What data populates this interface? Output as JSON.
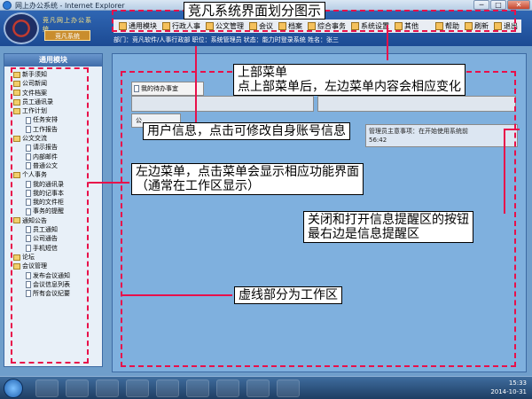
{
  "window": {
    "title": "网上办公系统 - Internet Explorer",
    "min": "─",
    "max": "□",
    "close": "✕"
  },
  "header": {
    "logo_text": "竞凡网上办公系统",
    "logo_sub": "竞凡系统",
    "top_menu": [
      "通用模块",
      "行政人事",
      "公文管理",
      "会议",
      "档案",
      "综合事务",
      "系统设置",
      "其他"
    ],
    "right_links": [
      "帮助",
      "刷新",
      "退出"
    ],
    "user_info": "部门：竞凡软件/人事行政部  职位：系统管理员  状态：能力时登录系统  姓名：张三"
  },
  "sidebar": {
    "title": "通用模块",
    "items": [
      {
        "label": "新手须知",
        "level": 0
      },
      {
        "label": "公司新闻",
        "level": 0
      },
      {
        "label": "文件档案",
        "level": 0
      },
      {
        "label": "员工通讯录",
        "level": 0
      },
      {
        "label": "工作计划",
        "level": 0
      },
      {
        "label": "任务安排",
        "level": 1
      },
      {
        "label": "工作报告",
        "level": 1
      },
      {
        "label": "公文交流",
        "level": 0
      },
      {
        "label": "请示报告",
        "level": 1
      },
      {
        "label": "内部邮件",
        "level": 1
      },
      {
        "label": "普通公文",
        "level": 1
      },
      {
        "label": "个人事务",
        "level": 0
      },
      {
        "label": "我的通讯录",
        "level": 1
      },
      {
        "label": "我的记事本",
        "level": 1
      },
      {
        "label": "我的文件柜",
        "level": 1
      },
      {
        "label": "事务的提醒",
        "level": 1
      },
      {
        "label": "通知公告",
        "level": 0
      },
      {
        "label": "员工通知",
        "level": 1
      },
      {
        "label": "公司通告",
        "level": 1
      },
      {
        "label": "手机短信",
        "level": 1
      },
      {
        "label": "论坛",
        "level": 0
      },
      {
        "label": "会议管理",
        "level": 0
      },
      {
        "label": "发布会议通知",
        "level": 1
      },
      {
        "label": "会议信息列表",
        "level": 1
      },
      {
        "label": "所有会议纪要",
        "level": 1
      }
    ]
  },
  "main": {
    "todo_tab": "我的待办事宜",
    "box_b": "公",
    "reminder_text": "管理员主意事项：在开始使用系统前",
    "reminder_time": "56:42"
  },
  "annotations": {
    "title": "竞凡系统界面划分图示",
    "top_menu": "上部菜单\n点上部菜单后，左边菜单内容会相应变化",
    "user_info": "用户信息，点击可修改自身账号信息",
    "left_menu": "左边菜单，点击菜单会显示相应功能界面\n（通常在工作区显示）",
    "toggle": "关闭和打开信息提醒区的按钮\n最右边是信息提醒区",
    "work_area": "虚线部分为工作区"
  },
  "taskbar": {
    "time": "15:33",
    "date": "2014-10-31"
  },
  "colors": {
    "annotation": "#e8104a",
    "header": "#1c4a93",
    "work_area": "#7fb0de"
  }
}
